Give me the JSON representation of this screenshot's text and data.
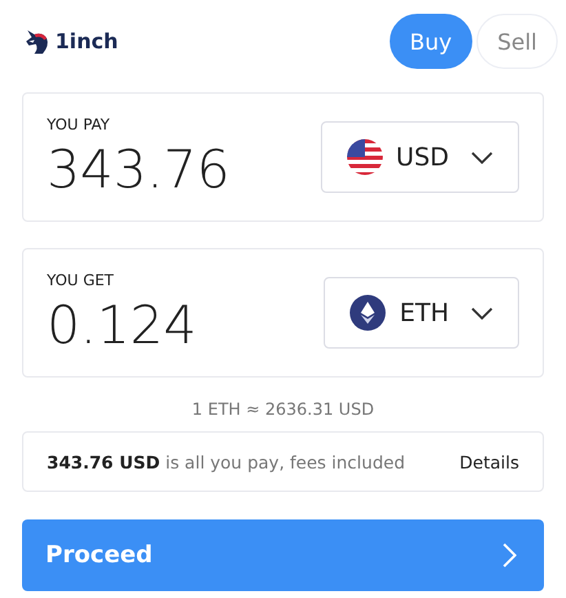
{
  "header": {
    "logo_text": "1inch",
    "tabs": [
      {
        "label": "Buy",
        "selected": true
      },
      {
        "label": "Sell",
        "selected": false
      }
    ]
  },
  "fields": [
    {
      "label": "YOU PAY",
      "value": "343.76",
      "currency": {
        "code": "USD",
        "kind": "usd"
      }
    },
    {
      "label": "YOU GET",
      "value": "0.124",
      "currency": {
        "code": "ETH",
        "kind": "eth"
      }
    }
  ],
  "rate": "1 ETH ≈ 2636.31 USD",
  "summary": {
    "text": "**343.76 USD** is all you pay, fees included",
    "link": "Details"
  },
  "proceed": {
    "label": "Proceed"
  }
}
